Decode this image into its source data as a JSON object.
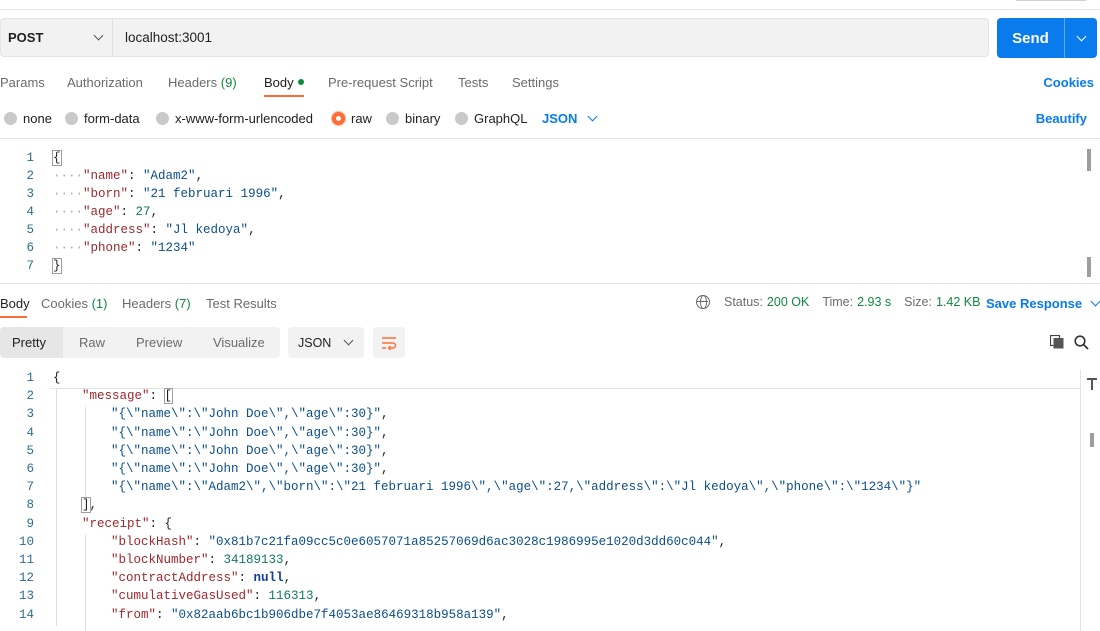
{
  "request": {
    "method": "POST",
    "url": "localhost:3001",
    "send_label": "Send"
  },
  "request_tabs": [
    {
      "label": "Params"
    },
    {
      "label": "Authorization"
    },
    {
      "label": "Headers",
      "count": "(9)"
    },
    {
      "label": "Body",
      "active": true
    },
    {
      "label": "Pre-request Script"
    },
    {
      "label": "Tests"
    },
    {
      "label": "Settings"
    }
  ],
  "cookies_label": "Cookies",
  "body_types": [
    {
      "label": "none"
    },
    {
      "label": "form-data"
    },
    {
      "label": "x-www-form-urlencoded"
    },
    {
      "label": "raw",
      "selected": true
    },
    {
      "label": "binary"
    },
    {
      "label": "GraphQL"
    }
  ],
  "raw_format": "JSON",
  "beautify_label": "Beautify",
  "request_body": {
    "line_numbers": [
      "1",
      "2",
      "3",
      "4",
      "5",
      "6",
      "7"
    ],
    "open": "{",
    "close": "}",
    "fields": [
      {
        "key": "\"name\"",
        "value": "\"Adam2\"",
        "trail": ","
      },
      {
        "key": "\"born\"",
        "value": "\"21 februari 1996\"",
        "trail": ","
      },
      {
        "key": "\"age\"",
        "value": "27",
        "trail": ","
      },
      {
        "key": "\"address\"",
        "value": "\"Jl kedoya\"",
        "trail": ","
      },
      {
        "key": "\"phone\"",
        "value": "\"1234\"",
        "trail": ""
      }
    ]
  },
  "response_tabs": [
    {
      "label": "Body",
      "active": true
    },
    {
      "label": "Cookies",
      "count": "(1)"
    },
    {
      "label": "Headers",
      "count": "(7)"
    },
    {
      "label": "Test Results"
    }
  ],
  "response_meta": {
    "status_label": "Status:",
    "status_value": "200 OK",
    "time_label": "Time:",
    "time_value": "2.93 s",
    "size_label": "Size:",
    "size_value": "1.42 KB",
    "save_label": "Save Response"
  },
  "view_modes": [
    {
      "label": "Pretty",
      "active": true
    },
    {
      "label": "Raw"
    },
    {
      "label": "Preview"
    },
    {
      "label": "Visualize"
    }
  ],
  "response_format": "JSON",
  "response_body": {
    "line_numbers": [
      "1",
      "2",
      "3",
      "4",
      "5",
      "6",
      "7",
      "8",
      "9",
      "10",
      "11",
      "12",
      "13",
      "14"
    ],
    "lines": [
      {
        "indent": 0,
        "parts": [
          [
            "p",
            "{"
          ]
        ]
      },
      {
        "indent": 1,
        "parts": [
          [
            "k",
            "\"message\""
          ],
          [
            "p",
            ": "
          ],
          [
            "box",
            "["
          ]
        ]
      },
      {
        "indent": 2,
        "parts": [
          [
            "s",
            "\"{\\\"name\\\":\\\"John Doe\\\",\\\"age\\\":30}\""
          ],
          [
            "p",
            ","
          ]
        ]
      },
      {
        "indent": 2,
        "parts": [
          [
            "s",
            "\"{\\\"name\\\":\\\"John Doe\\\",\\\"age\\\":30}\""
          ],
          [
            "p",
            ","
          ]
        ]
      },
      {
        "indent": 2,
        "parts": [
          [
            "s",
            "\"{\\\"name\\\":\\\"John Doe\\\",\\\"age\\\":30}\""
          ],
          [
            "p",
            ","
          ]
        ]
      },
      {
        "indent": 2,
        "parts": [
          [
            "s",
            "\"{\\\"name\\\":\\\"John Doe\\\",\\\"age\\\":30}\""
          ],
          [
            "p",
            ","
          ]
        ]
      },
      {
        "indent": 2,
        "parts": [
          [
            "s",
            "\"{\\\"name\\\":\\\"Adam2\\\",\\\"born\\\":\\\"21 februari 1996\\\",\\\"age\\\":27,\\\"address\\\":\\\"Jl kedoya\\\",\\\"phone\\\":\\\"1234\\\"}\""
          ]
        ]
      },
      {
        "indent": 1,
        "parts": [
          [
            "box",
            "]"
          ],
          [
            "p",
            ","
          ]
        ]
      },
      {
        "indent": 1,
        "parts": [
          [
            "k",
            "\"receipt\""
          ],
          [
            "p",
            ": {"
          ]
        ]
      },
      {
        "indent": 2,
        "parts": [
          [
            "k",
            "\"blockHash\""
          ],
          [
            "p",
            ": "
          ],
          [
            "s",
            "\"0x81b7c21fa09cc5c0e6057071a85257069d6ac3028c1986995e1020d3dd60c044\""
          ],
          [
            "p",
            ","
          ]
        ]
      },
      {
        "indent": 2,
        "parts": [
          [
            "k",
            "\"blockNumber\""
          ],
          [
            "p",
            ": "
          ],
          [
            "n",
            "34189133"
          ],
          [
            "p",
            ","
          ]
        ]
      },
      {
        "indent": 2,
        "parts": [
          [
            "k",
            "\"contractAddress\""
          ],
          [
            "p",
            ": "
          ],
          [
            "b",
            "null"
          ],
          [
            "p",
            ","
          ]
        ]
      },
      {
        "indent": 2,
        "parts": [
          [
            "k",
            "\"cumulativeGasUsed\""
          ],
          [
            "p",
            ": "
          ],
          [
            "n",
            "116313"
          ],
          [
            "p",
            ","
          ]
        ]
      },
      {
        "indent": 2,
        "parts": [
          [
            "k",
            "\"from\""
          ],
          [
            "p",
            ": "
          ],
          [
            "s",
            "\"0x82aab6bc1b906dbe7f4053ae86469318b958a139\""
          ],
          [
            "p",
            ","
          ]
        ]
      }
    ]
  },
  "colors": {
    "accent": "#097bed",
    "active_tab": "#ff6c37",
    "success": "#0f8a3d"
  },
  "icons": [
    "chevron-down-icon",
    "globe-icon",
    "wrap-lines-icon",
    "copy-icon",
    "search-icon"
  ]
}
